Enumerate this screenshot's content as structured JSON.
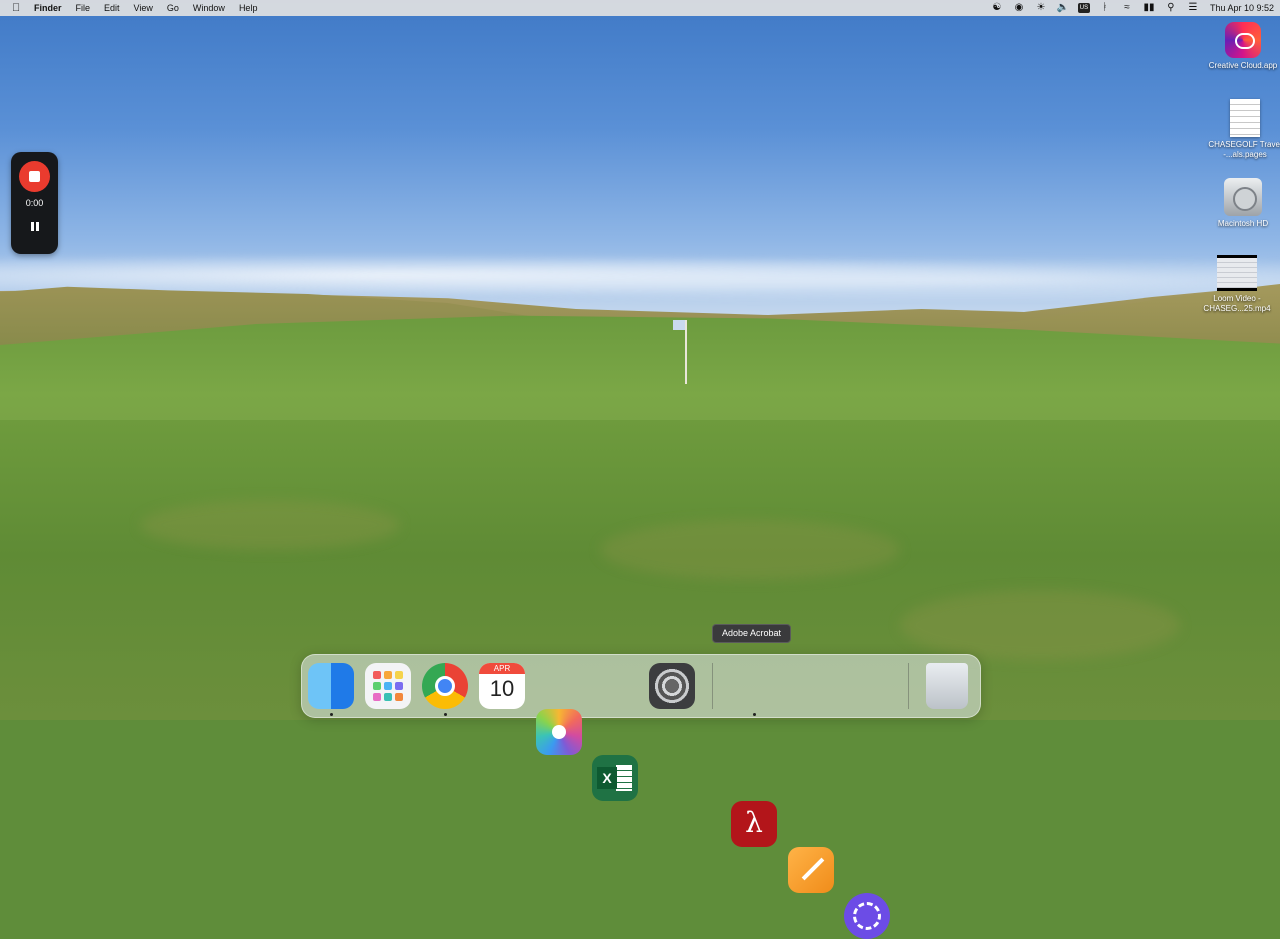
{
  "menubar": {
    "apple_icon": "apple-logo-icon",
    "app_name": "Finder",
    "menus": [
      "File",
      "Edit",
      "View",
      "Go",
      "Window",
      "Help"
    ],
    "status_icons": [
      "creative-cloud-status-icon",
      "screen-recording-status-icon",
      "brightness-icon",
      "volume-icon",
      "input-source-icon",
      "bluetooth-icon",
      "wifi-icon",
      "battery-icon",
      "spotlight-search-icon",
      "control-center-icon"
    ],
    "input_source": "US",
    "clock": "Thu Apr 10  9:52"
  },
  "recorder": {
    "stop_icon": "stop-icon",
    "time": "0:00",
    "pause_icon": "pause-icon",
    "accent_color": "#ea3b2e"
  },
  "desktop": {
    "items": [
      {
        "label": "Creative Cloud.app",
        "icon": "creative-cloud-icon"
      },
      {
        "label": "CHASEGOLF Travel -...als.pages",
        "icon": "pages-document-icon"
      },
      {
        "label": "Macintosh HD",
        "icon": "hard-drive-icon"
      },
      {
        "label": "Loom Video - CHASEG...25.mp4",
        "icon": "video-file-icon"
      }
    ]
  },
  "tooltip": {
    "text": "Adobe Acrobat"
  },
  "dock": {
    "apps": [
      {
        "name": "Finder",
        "icon": "finder-icon",
        "running": true
      },
      {
        "name": "Launchpad",
        "icon": "launchpad-icon",
        "running": false
      },
      {
        "name": "Google Chrome",
        "icon": "chrome-icon",
        "running": true
      },
      {
        "name": "Calendar",
        "icon": "calendar-icon",
        "running": false,
        "month": "APR",
        "day": "10"
      },
      {
        "name": "Photos",
        "icon": "photos-icon",
        "running": false
      },
      {
        "name": "Microsoft Excel",
        "icon": "excel-icon",
        "running": false,
        "glyph": "X"
      },
      {
        "name": "System Settings",
        "icon": "settings-icon",
        "running": false
      },
      {
        "name": "Adobe Acrobat",
        "icon": "acrobat-icon",
        "running": true
      },
      {
        "name": "Pages",
        "icon": "pages-icon",
        "running": false
      },
      {
        "name": "Perplexity",
        "icon": "perplexity-icon",
        "running": false
      },
      {
        "name": "Trash",
        "icon": "trash-icon",
        "running": false
      }
    ]
  }
}
